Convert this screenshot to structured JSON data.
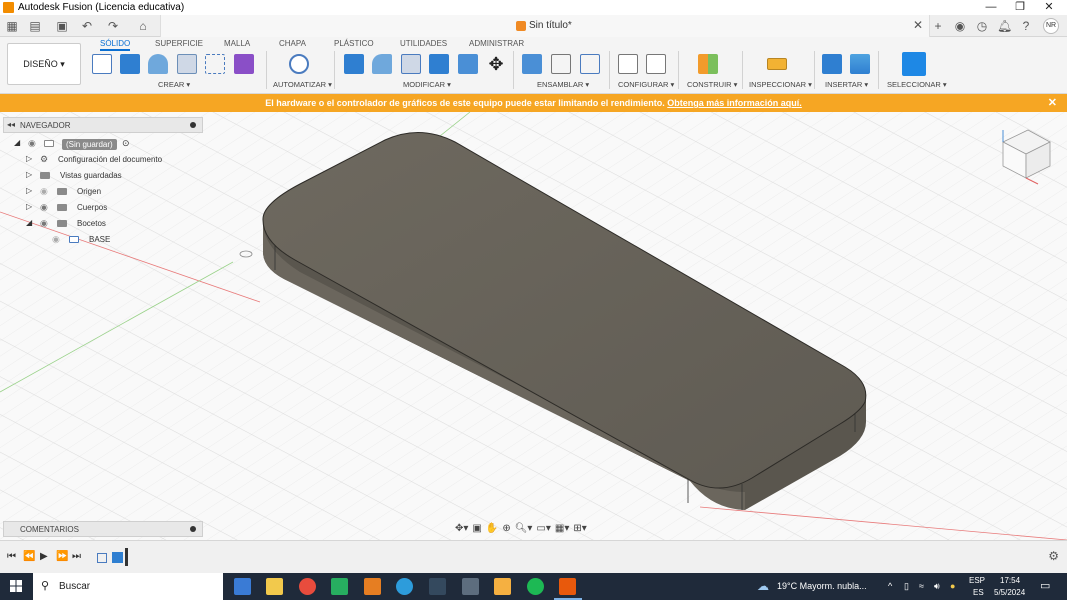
{
  "window": {
    "title": "Autodesk Fusion (Licencia educativa)",
    "doc_title": "Sin título*",
    "avatar": "NR"
  },
  "ribbon": {
    "workspace": "DISEÑO ▾",
    "tabs": [
      "SÓLIDO",
      "SUPERFICIE",
      "MALLA",
      "CHAPA",
      "PLÁSTICO",
      "UTILIDADES",
      "ADMINISTRAR"
    ],
    "groups": [
      "CREAR ▾",
      "AUTOMATIZAR ▾",
      "MODIFICAR ▾",
      "ENSAMBLAR ▾",
      "CONFIGURAR ▾",
      "CONSTRUIR ▾",
      "INSPECCIONAR ▾",
      "INSERTAR ▾",
      "SELECCIONAR ▾"
    ]
  },
  "warning": {
    "text": "El hardware o el controlador de gráficos de este equipo puede estar limitando el rendimiento. ",
    "link": "Obtenga más información aquí."
  },
  "navigator": {
    "title": "NAVEGADOR",
    "root": "(Sin guardar)",
    "items": [
      "Configuración del documento",
      "Vistas guardadas",
      "Origen",
      "Cuerpos",
      "Bocetos",
      "BASE"
    ]
  },
  "comments": {
    "title": "COMENTARIOS"
  },
  "taskbar": {
    "search": "Buscar",
    "weather": "19°C  Mayorm. nubla...",
    "lang": "ESP",
    "lang2": "ES",
    "time": "17:54",
    "date": "5/5/2024"
  },
  "colors": {
    "accent": "#0a6fd2",
    "warning": "#f6a623",
    "body": "#6f6a60"
  }
}
